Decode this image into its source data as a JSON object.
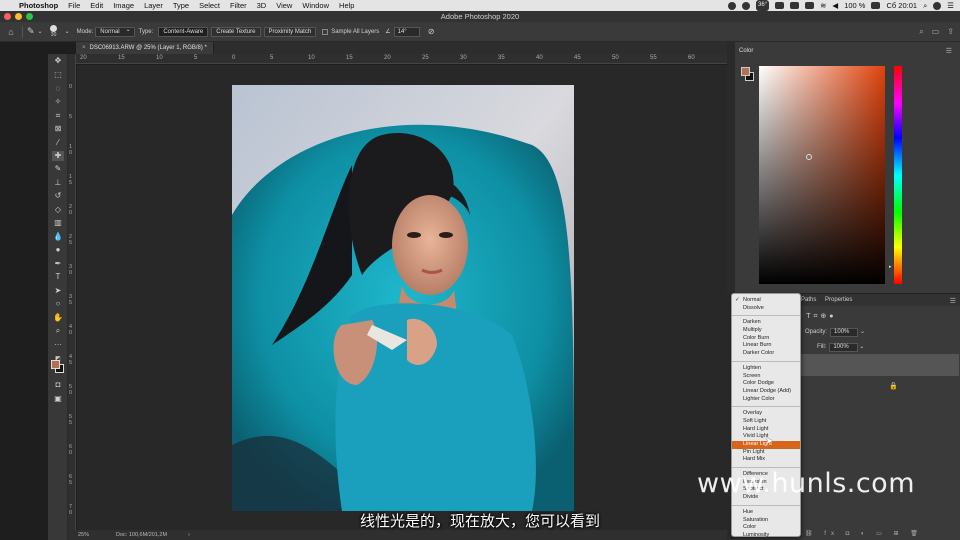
{
  "menubar": {
    "items": [
      "Photoshop",
      "File",
      "Edit",
      "Image",
      "Layer",
      "Type",
      "Select",
      "Filter",
      "3D",
      "View",
      "Window",
      "Help"
    ],
    "weather": "36°",
    "battery": "100 %",
    "clock": "Сб 20:01"
  },
  "window": {
    "title": "Adobe Photoshop 2020"
  },
  "options": {
    "brush_size": "30",
    "mode_label": "Mode:",
    "mode_value": "Normal",
    "type_label": "Type:",
    "type_buttons": [
      "Content-Aware",
      "Create Texture",
      "Proximity Match"
    ],
    "sample_all_layers": "Sample All Layers",
    "angle_value": "14°"
  },
  "document": {
    "tab_title": "DSC06913.ARW @ 25% (Layer 1, RGB/8) *"
  },
  "ruler": {
    "top_labels": [
      "20",
      "15",
      "10",
      "5",
      "0",
      "5",
      "10",
      "15",
      "20",
      "25",
      "30",
      "35",
      "40",
      "45",
      "50",
      "55",
      "60"
    ],
    "left_labels": [
      "0",
      "5",
      "1 0",
      "1 5",
      "2 0",
      "2 5",
      "3 0",
      "3 5",
      "4 0",
      "4 5",
      "5 0",
      "5 5",
      "6 0",
      "6 5",
      "7 0"
    ]
  },
  "status": {
    "zoom": "25%",
    "doc": "Doc: 100,6M/201,2M",
    "arrow": "›"
  },
  "color_panel": {
    "tab": "Color"
  },
  "colors": {
    "foreground": "#b07252",
    "background": "#111111",
    "accent_highlight": "#d6661c"
  },
  "layers_panel": {
    "tabs": [
      "Paths",
      "Properties"
    ],
    "opacity_label": "Opacity:",
    "opacity_value": "100%",
    "fill_label": "Fill:",
    "fill_value": "100%"
  },
  "blend_modes": {
    "groups": [
      [
        "Normal",
        "Dissolve"
      ],
      [
        "Darken",
        "Multiply",
        "Color Burn",
        "Linear Burn",
        "Darker Color"
      ],
      [
        "Lighten",
        "Screen",
        "Color Dodge",
        "Linear Dodge (Add)",
        "Lighter Color"
      ],
      [
        "Overlay",
        "Soft Light",
        "Hard Light",
        "Vivid Light",
        "Linear Light",
        "Pin Light",
        "Hard Mix"
      ],
      [
        "Difference",
        "Exclusion",
        "Subtract",
        "Divide"
      ],
      [
        "Hue",
        "Saturation",
        "Color",
        "Luminosity"
      ]
    ],
    "checked": "Normal",
    "highlighted": "Linear Light"
  },
  "subtitle": "线性光是的，现在放大，您可以看到",
  "watermark": "www.hunls.com"
}
